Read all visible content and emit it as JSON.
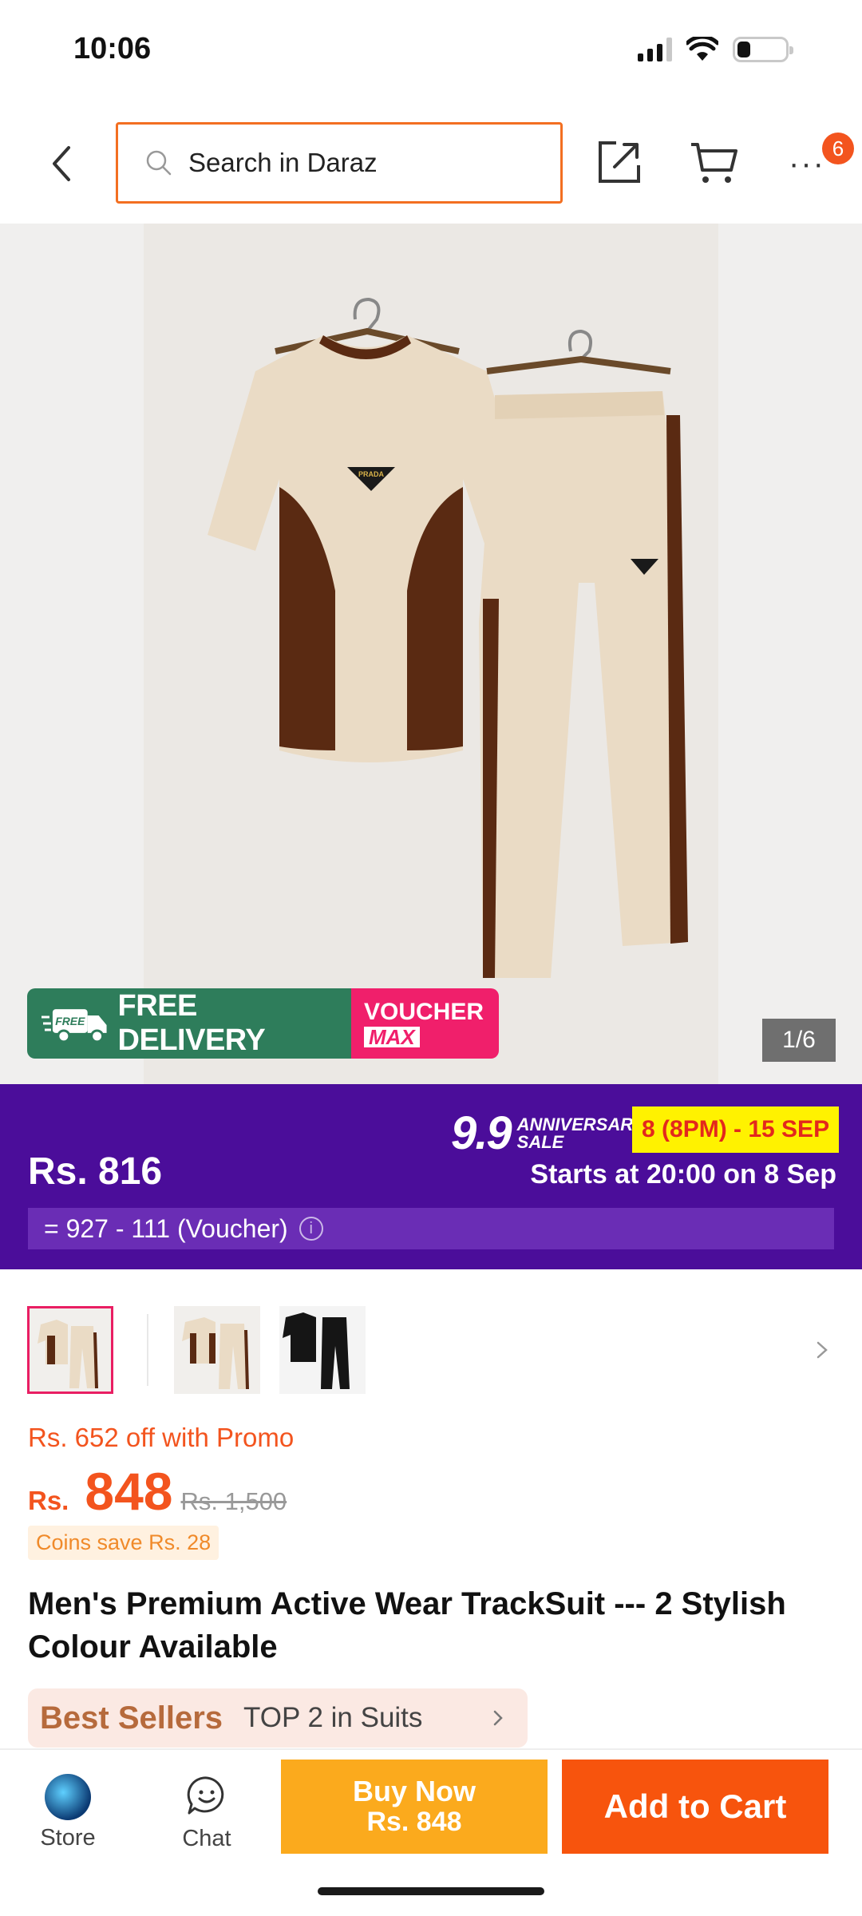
{
  "status_bar": {
    "time": "10:06"
  },
  "search": {
    "placeholder": "Search in Daraz"
  },
  "nav": {
    "cart_badge": "6"
  },
  "gallery": {
    "counter": "1/6",
    "delivery_label": "FREE DELIVERY",
    "delivery_tag": "FREE",
    "voucher_line1": "VOUCHER",
    "voucher_line2": "MAX",
    "logo_text": "PRADA"
  },
  "sale_banner": {
    "price": "Rs. 816",
    "event_big": "9.9",
    "event_small_1": "ANNIVERSARY",
    "event_small_2": "SALE",
    "dates": "8 (8PM) - 15 SEP",
    "starts": "Starts at 20:00 on 8 Sep",
    "breakdown": "= 927 - 111 (Voucher)"
  },
  "pricing": {
    "promo": "Rs. 652 off with Promo",
    "currency": "Rs.",
    "amount": "848",
    "original": "Rs. 1,500",
    "coins": "Coins save Rs. 28"
  },
  "product": {
    "title": "Men's Premium Active Wear TrackSuit --- 2 Stylish Colour Available"
  },
  "best_sellers": {
    "logo": "Best Sellers",
    "rank": "TOP 2 in Suits"
  },
  "bottom_bar": {
    "store_label": "Store",
    "chat_label": "Chat",
    "buy_now_line1": "Buy Now",
    "buy_now_line2": "Rs. 848",
    "add_to_cart": "Add to Cart"
  },
  "colors": {
    "accent": "#f3541e",
    "sale_purple": "#4b0d9a",
    "buy_now": "#fbaa1d",
    "add_to_cart": "#f7540d",
    "delivery_green": "#2e7d5b",
    "voucher_pink": "#f01f6b"
  }
}
